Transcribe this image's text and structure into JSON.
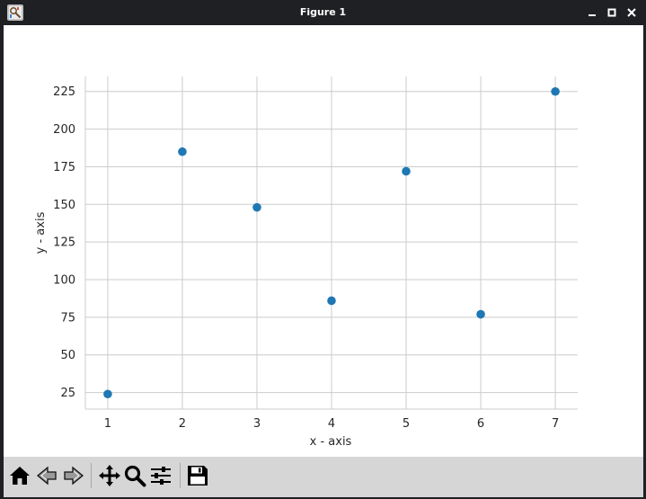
{
  "window": {
    "title": "Figure 1"
  },
  "icons": {
    "app": "figure-app-icon",
    "minimize": "minimize-icon",
    "maximize": "maximize-icon",
    "close": "close-icon"
  },
  "toolbar": {
    "buttons": [
      {
        "name": "home-button",
        "icon": "home-icon"
      },
      {
        "name": "back-button",
        "icon": "arrow-left-icon"
      },
      {
        "name": "forward-button",
        "icon": "arrow-right-icon"
      },
      {
        "name": "pan-button",
        "icon": "move-icon"
      },
      {
        "name": "zoom-button",
        "icon": "magnifier-icon"
      },
      {
        "name": "configure-subplots-button",
        "icon": "sliders-icon"
      },
      {
        "name": "save-button",
        "icon": "floppy-disk-icon"
      }
    ]
  },
  "chart_data": {
    "type": "scatter",
    "x": [
      1,
      2,
      3,
      4,
      5,
      6,
      7
    ],
    "y": [
      24,
      185,
      148,
      86,
      172,
      77,
      225
    ],
    "xlabel": "x - axis",
    "ylabel": "y - axis",
    "xlim": [
      0.7,
      7.3
    ],
    "ylim": [
      14,
      235
    ],
    "xticks": [
      1,
      2,
      3,
      4,
      5,
      6,
      7
    ],
    "yticks": [
      25,
      50,
      75,
      100,
      125,
      150,
      175,
      200,
      225
    ],
    "grid": true,
    "color": "#1f77b4"
  }
}
